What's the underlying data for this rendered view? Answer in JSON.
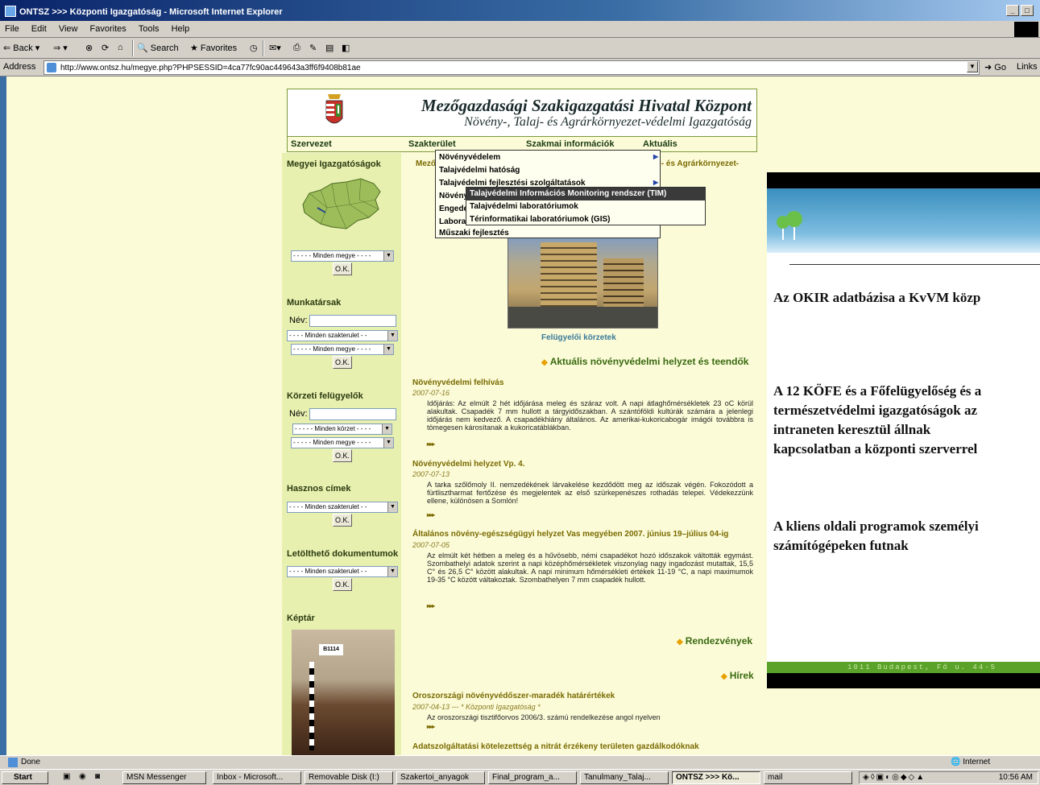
{
  "window": {
    "title": "ONTSZ >>> Központi Igazgatóság - Microsoft Internet Explorer"
  },
  "menubar": [
    "File",
    "Edit",
    "View",
    "Favorites",
    "Tools",
    "Help"
  ],
  "toolbar": {
    "back": "Back",
    "search": "Search",
    "favorites": "Favorites"
  },
  "address": {
    "label": "Address",
    "url": "http://www.ontsz.hu/megye.php?PHPSESSID=4ca77fc90ac449643a3ff6f9408b81ae",
    "go": "Go",
    "links": "Links"
  },
  "header": {
    "title": "Mezőgazdasági Szakigazgatási Hivatal Központ",
    "subtitle": "Növény-, Talaj- és Agrárkörnyezet-védelmi Igazgatóság"
  },
  "nav": [
    "Szervezet",
    "Szakterület",
    "Szakmai információk",
    "Aktuális"
  ],
  "menu1": {
    "items": [
      "Növényvédelem",
      "Talajvédelmi hatóság",
      "Talajvédelmi fejlesztési szolgáltatások",
      "Növény",
      "Engedé",
      "Labora",
      "Műszaki fejlesztés"
    ],
    "submenu_arrow": "▶"
  },
  "menu2": {
    "items": [
      "Talajvédelmi Információs Monitoring rendszer (TIM)",
      "Talajvédelmi laboratóriumok",
      "Térinformatikai laboratóriumok (GIS)"
    ]
  },
  "main_header_fragments": {
    "left": "Mező",
    "right": "j- és Agrárkörnyezet-"
  },
  "left": {
    "megyei_title": "Megyei Igazgatóságok",
    "select_megye": "- - - - - Minden megye - - - -",
    "ok": "O.K.",
    "munkatarsak_title": "Munkatársak",
    "nev_label": "Név:",
    "select_szakterulet": "- - - - Minden szakterulet - -",
    "korzeti_title": "Körzeti felügyelők",
    "select_korzet": "- - - - - Minden körzet - - - -",
    "hasznos_title": "Hasznos címek",
    "letoltheto_title": "Letölthető dokumentumok",
    "keptar_title": "Képtár",
    "photo_label": "B1114"
  },
  "main": {
    "building_caption": "Felügyelői körzetek",
    "section_aktualis": "Aktuális növényvédelmi helyzet és teendők",
    "articles": [
      {
        "title": "Növényvédelmi felhívás",
        "date": "2007-07-16",
        "body": "Időjárás: Az elmúlt 2 hét időjárása meleg és száraz volt. A napi átlaghőmérsékletek 23 oC körül alakultak. Csapadék 7 mm hullott a tárgyidőszakban. A szántóföldi kultúrák számára a jelenlegi időjárás nem kedvező. A csapadékhiány általános. Az amerikai-kukoricabogár imágói továbbra is tömegesen károsítanak a kukoricatáblákban."
      },
      {
        "title": "Növényvédelmi helyzet Vp. 4.",
        "date": "2007-07-13",
        "body": "A tarka szőlőmoly II. nemzedékének lárvakelése kezdődött meg az időszak végén. Fokozódott a fürtlisztharmat fertőzése és megjelentek az első szürkepenészes rothadás telepei. Védekezzünk ellene, különösen a Somlón!"
      },
      {
        "title": "Általános növény-egészségügyi helyzet Vas megyében 2007. június 19–július 04-ig",
        "date": "2007-07-05",
        "body": "Az elmúlt két hétben a meleg és a hűvösebb, némi csapadékot hozó időszakok váltották egymást. Szombathelyi adatok szerint a napi középhőmérsékletek viszonylag nagy ingadozást mutattak, 15,5 C° és 26,5 C° között alakultak. A napi minimum hőmérsékleti értékek 11-19 °C, a napi maximumok 19-35 °C között váltakoztak. Szombathelyen 7 mm csapadék hullott."
      }
    ],
    "more": "▸▸▸",
    "section_rendezvenyek": "Rendezvények",
    "section_hirek": "Hírek",
    "news": [
      {
        "title": "Oroszországi növényvédőszer-maradék határértékek",
        "date": "2007-04-13  ---  * Központi Igazgatóság *",
        "body": "Az oroszországi tisztifőorvos 2006/3. számú rendelkezése angol nyelven"
      },
      {
        "title": "Adatszolgáltatási kötelezettség a nitrát érzékeny területen gazdálkodóknak"
      }
    ]
  },
  "slide": {
    "lines": [
      "Az OKIR adatbázisa a KvVM közp",
      "A 12 KÖFE és a Főfelügyelőség és a",
      "természetvédelmi igazgatóságok az",
      "intraneten keresztül állnak",
      "kapcsolatban a központi szerverrel",
      "A kliens oldali programok személyi",
      "számítógépeken futnak"
    ],
    "footer": "1011 Budapest, Fő u. 44-5"
  },
  "status": {
    "text": "Done",
    "zone": "Internet"
  },
  "taskbar": {
    "start": "Start",
    "tasks": [
      "MSN Messenger",
      "Inbox - Microsoft...",
      "Removable Disk (I:)",
      "Szakertoi_anyagok",
      "Final_program_a...",
      "Tanulmany_Talaj...",
      "ONTSZ >>> Kö...",
      "mail"
    ],
    "clock": "10:56 AM"
  }
}
